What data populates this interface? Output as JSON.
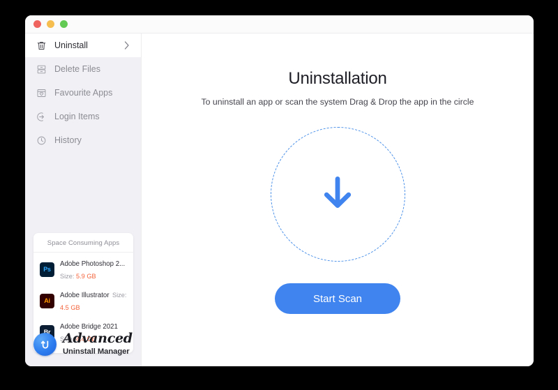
{
  "window": {
    "traffic_lights": [
      {
        "name": "close",
        "color": "#f0645f"
      },
      {
        "name": "minimize",
        "color": "#f6bd4f"
      },
      {
        "name": "zoom",
        "color": "#63cb53"
      }
    ]
  },
  "sidebar": {
    "items": [
      {
        "label": "Uninstall",
        "icon": "trash-icon",
        "active": true,
        "chevron": "›"
      },
      {
        "label": "Delete Files",
        "icon": "file-drawer-icon",
        "active": false
      },
      {
        "label": "Favourite Apps",
        "icon": "window-heart-icon",
        "active": false
      },
      {
        "label": "Login Items",
        "icon": "login-arrow-icon",
        "active": false
      },
      {
        "label": "History",
        "icon": "clock-icon",
        "active": false
      }
    ],
    "card": {
      "title": "Space Consuming Apps",
      "size_label": "Size:",
      "apps": [
        {
          "name": "Adobe Photoshop 2...",
          "size": "5.9 GB",
          "badge": "Ps",
          "badge_bg": "#001e36",
          "badge_fg": "#31a8ff"
        },
        {
          "name": "Adobe Illustrator",
          "size": "4.5 GB",
          "badge": "Ai",
          "badge_bg": "#330000",
          "badge_fg": "#ff9a00"
        },
        {
          "name": "Adobe Bridge 2021",
          "size": "4.4 GB",
          "badge": "Br",
          "badge_bg": "#0c1e33",
          "badge_fg": "#ffffff"
        }
      ]
    },
    "brand": {
      "top": "Advanced",
      "bottom": "Uninstall Manager",
      "badge_icon": "u-mark-icon"
    }
  },
  "main": {
    "title": "Uninstallation",
    "subtitle": "To uninstall an app or scan the system Drag & Drop the app in the circle",
    "dropzone_icon": "download-arrow-icon",
    "start_scan_label": "Start Scan"
  },
  "colors": {
    "accent": "#3f84ef",
    "dashed_border": "#4a90e8",
    "size_value": "#f4623a",
    "sidebar_bg": "#f1f1f5"
  }
}
